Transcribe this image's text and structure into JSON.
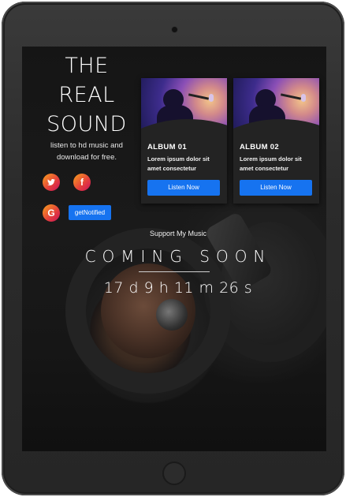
{
  "brand": {
    "line1": "THE",
    "line2": "REAL",
    "line3": "SOUND"
  },
  "tagline": "listen to hd music and download for free.",
  "social": [
    {
      "name": "twitter",
      "icon": "twitter-icon"
    },
    {
      "name": "facebook",
      "icon": "facebook-icon",
      "glyph": "f"
    },
    {
      "name": "google",
      "icon": "google-icon",
      "glyph": "G"
    }
  ],
  "notify_button": "getNotified",
  "albums": [
    {
      "title": "ALBUM 01",
      "description": "Lorem ipsum dolor sit amet consectetur",
      "button": "Listen Now"
    },
    {
      "title": "ALBUM 02",
      "description": "Lorem ipsum dolor sit amet consectetur",
      "button": "Listen Now"
    }
  ],
  "support_text": "Support My Music",
  "coming_soon": "COMING SOON",
  "countdown": "17 d 9 h 11 m 26 s",
  "colors": {
    "accent": "#1673f0",
    "social_gradient_start": "#f7a21d",
    "social_gradient_end": "#c8105c"
  }
}
